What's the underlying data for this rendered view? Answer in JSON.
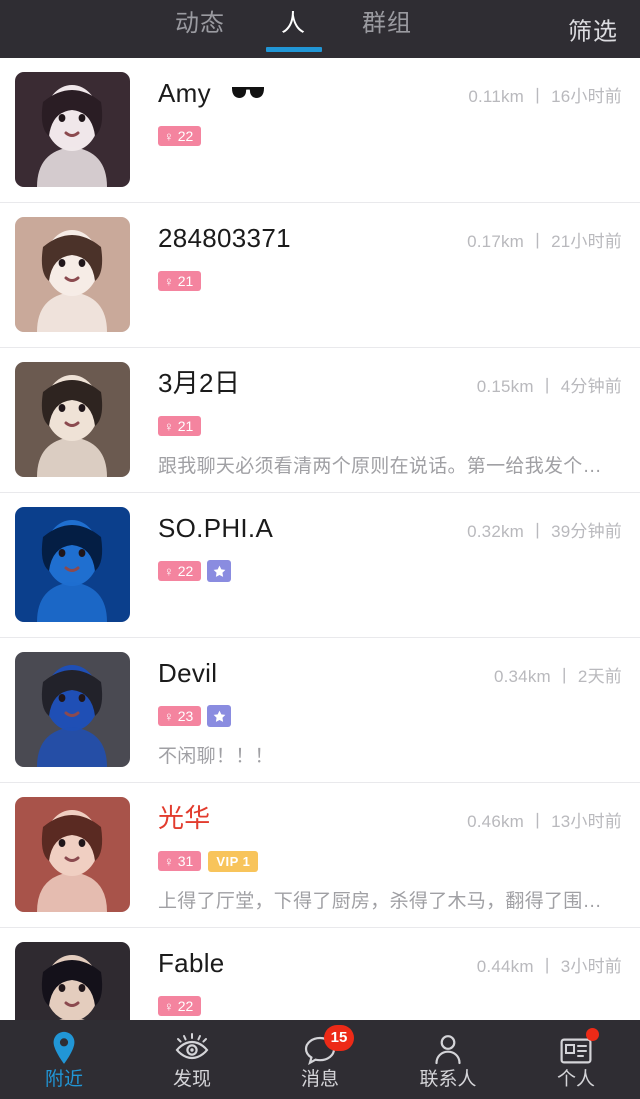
{
  "header": {
    "tabs": [
      {
        "label": "动态",
        "active": false
      },
      {
        "label": "人",
        "active": true
      },
      {
        "label": "群组",
        "active": false
      }
    ],
    "filter_label": "筛选",
    "active_underline_color": "#2196d6",
    "background_color": "#2f2d33"
  },
  "colors": {
    "female_badge": "#f4849f",
    "star_badge": "#8a8ce0",
    "vip_badge": "#f8c45b",
    "vip_name": "#e23c2e",
    "accent_blue": "#2196d6",
    "notification_red": "#ed2a17",
    "meta_text": "#b9b9bd",
    "signature_text": "#a0a0a4"
  },
  "list": {
    "items": [
      {
        "name": "Amy",
        "name_is_vip": false,
        "emoji": "sunglasses",
        "gender_symbol": "♀",
        "age": "22",
        "has_star": false,
        "vip_label": "",
        "distance": "0.11km",
        "separator": "丨",
        "time": "16小时前",
        "meta": "0.11km 丨 16小时前",
        "signature": "",
        "avatar_name": "avatar-amy"
      },
      {
        "name": "284803371",
        "name_is_vip": false,
        "emoji": "",
        "gender_symbol": "♀",
        "age": "21",
        "has_star": false,
        "vip_label": "",
        "distance": "0.17km",
        "separator": "丨",
        "time": "21小时前",
        "meta": "0.17km 丨 21小时前",
        "signature": "",
        "avatar_name": "avatar-284803371"
      },
      {
        "name": "3月2日",
        "name_is_vip": false,
        "emoji": "",
        "gender_symbol": "♀",
        "age": "21",
        "has_star": false,
        "vip_label": "",
        "distance": "0.15km",
        "separator": "丨",
        "time": "4分钟前",
        "meta": "0.15km 丨 4分钟前",
        "signature": "跟我聊天必须看清两个原则在说话。第一给我发个…",
        "avatar_name": "avatar-3yue2ri"
      },
      {
        "name": "SO.PHI.A",
        "name_is_vip": false,
        "emoji": "",
        "gender_symbol": "♀",
        "age": "22",
        "has_star": true,
        "vip_label": "",
        "distance": "0.32km",
        "separator": "丨",
        "time": "39分钟前",
        "meta": "0.32km 丨 39分钟前",
        "signature": "",
        "avatar_name": "avatar-sophia"
      },
      {
        "name": "Devil",
        "name_is_vip": false,
        "emoji": "",
        "gender_symbol": "♀",
        "age": "23",
        "has_star": true,
        "vip_label": "",
        "distance": "0.34km",
        "separator": "丨",
        "time": "2天前",
        "meta": "0.34km 丨 2天前",
        "signature": "不闲聊！！！",
        "avatar_name": "avatar-devil"
      },
      {
        "name": "光华",
        "name_is_vip": true,
        "emoji": "",
        "gender_symbol": "♀",
        "age": "31",
        "has_star": false,
        "vip_label": "VIP 1",
        "distance": "0.46km",
        "separator": "丨",
        "time": "13小时前",
        "meta": "0.46km 丨 13小时前",
        "signature": "上得了厅堂，下得了厨房，杀得了木马，翻得了围…",
        "avatar_name": "avatar-guanghua"
      },
      {
        "name": "Fable",
        "name_is_vip": false,
        "emoji": "",
        "gender_symbol": "♀",
        "age": "22",
        "has_star": false,
        "vip_label": "",
        "distance": "0.44km",
        "separator": "丨",
        "time": "3小时前",
        "meta": "0.44km 丨 3小时前",
        "signature": "",
        "avatar_name": "avatar-fable"
      }
    ]
  },
  "bottom_nav": {
    "items": [
      {
        "label": "附近",
        "icon": "location-pin-icon",
        "active": true,
        "badge_count": "",
        "badge_dot": false
      },
      {
        "label": "发现",
        "icon": "eye-icon",
        "active": false,
        "badge_count": "",
        "badge_dot": false
      },
      {
        "label": "消息",
        "icon": "chat-bubble-icon",
        "active": false,
        "badge_count": "15",
        "badge_dot": false
      },
      {
        "label": "联系人",
        "icon": "person-icon",
        "active": false,
        "badge_count": "",
        "badge_dot": false
      },
      {
        "label": "个人",
        "icon": "id-card-icon",
        "active": false,
        "badge_count": "",
        "badge_dot": true
      }
    ]
  }
}
